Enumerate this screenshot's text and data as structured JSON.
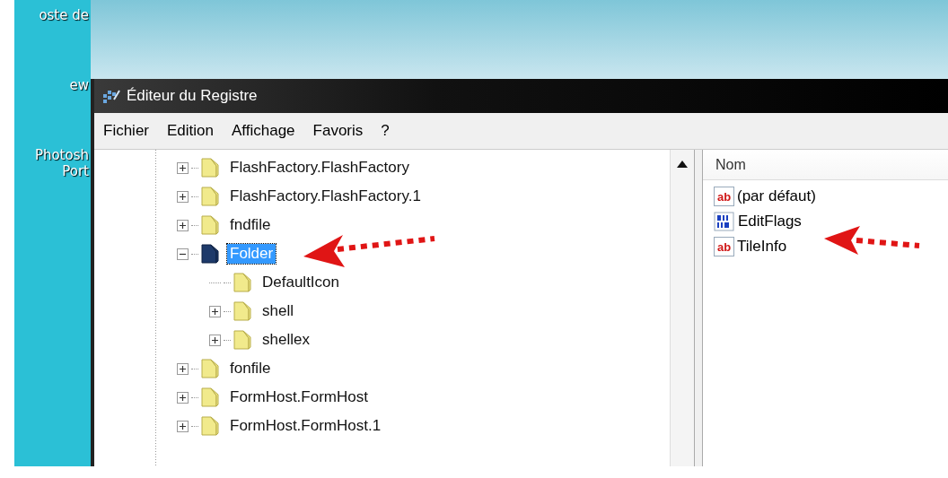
{
  "desktop": {
    "icons": [
      {
        "label": "oste de"
      },
      {
        "label": "ew"
      },
      {
        "label": "Photosh Port"
      }
    ]
  },
  "window": {
    "title": "Éditeur du Registre"
  },
  "menu": [
    "Fichier",
    "Edition",
    "Affichage",
    "Favoris",
    "?"
  ],
  "tree": [
    {
      "label": "FlashFactory.FlashFactory",
      "expanded": false,
      "selected": false
    },
    {
      "label": "FlashFactory.FlashFactory.1",
      "expanded": false,
      "selected": false
    },
    {
      "label": "fndfile",
      "expanded": false,
      "selected": false
    },
    {
      "label": "Folder",
      "expanded": true,
      "selected": true,
      "children": [
        {
          "label": "DefaultIcon",
          "selected": false
        },
        {
          "label": "shell",
          "expanded": false,
          "selected": false
        },
        {
          "label": "shellex",
          "expanded": false,
          "selected": false
        }
      ]
    },
    {
      "label": "fonfile",
      "expanded": false,
      "selected": false
    },
    {
      "label": "FormHost.FormHost",
      "expanded": false,
      "selected": false
    },
    {
      "label": "FormHost.FormHost.1",
      "expanded": false,
      "selected": false
    }
  ],
  "values": {
    "columns": [
      "Nom"
    ],
    "rows": [
      {
        "name": "(par défaut)",
        "kind": "string",
        "icon_text": "ab"
      },
      {
        "name": "EditFlags",
        "kind": "binary"
      },
      {
        "name": "TileInfo",
        "kind": "string",
        "icon_text": "ab"
      }
    ]
  }
}
